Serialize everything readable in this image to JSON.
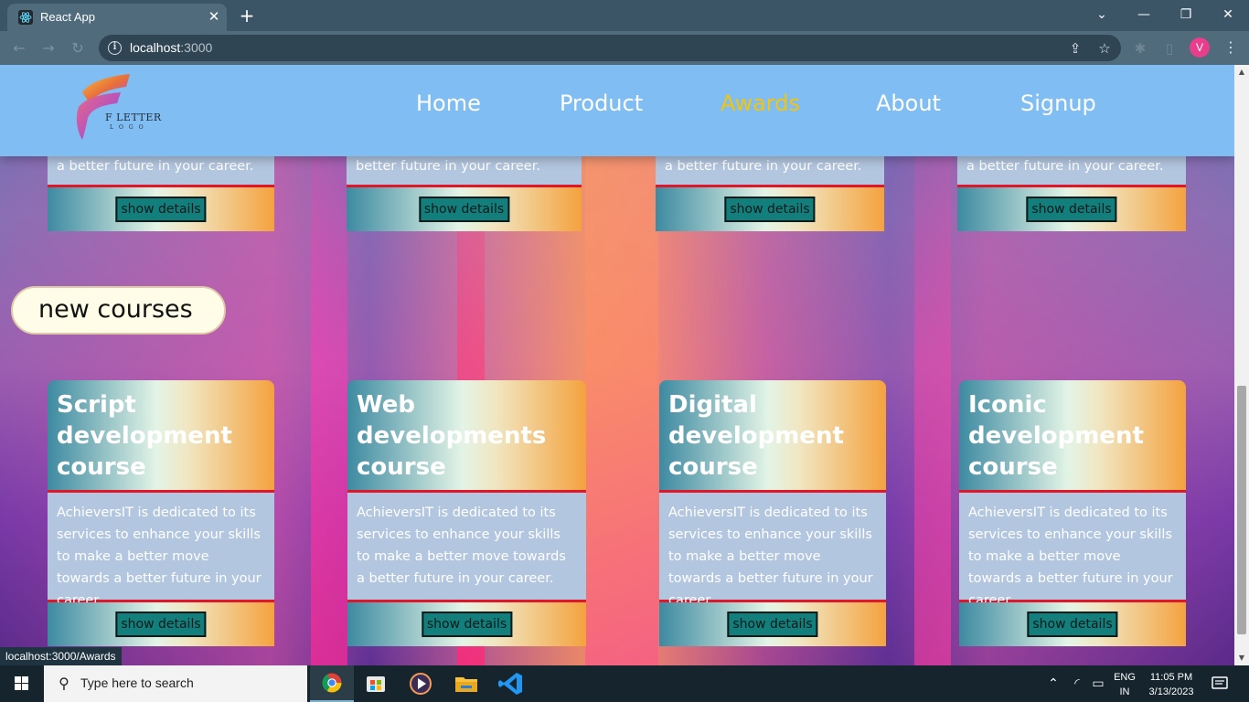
{
  "browser": {
    "tab_title": "React App",
    "tab_close": "✕",
    "new_tab": "+",
    "url_host": "localhost",
    "url_port": ":3000",
    "profile_initial": "V",
    "status_url": "localhost:3000/Awards",
    "window_controls": {
      "chevron": "⌄",
      "minimize": "—",
      "restore": "❐",
      "close": "✕"
    }
  },
  "site": {
    "logo_text": "F LETTER",
    "logo_sub": "LOGO",
    "nav": [
      {
        "label": "Home",
        "active": false
      },
      {
        "label": "Product",
        "active": false
      },
      {
        "label": "Awards",
        "active": true
      },
      {
        "label": "About",
        "active": false
      },
      {
        "label": "Signup",
        "active": false
      }
    ],
    "active_color": "#f1c40f",
    "header_color": "#80bdf2"
  },
  "top_cards": [
    {
      "text_tail": "a better future in your career.",
      "button": "show details"
    },
    {
      "text_tail": "better future in your career.",
      "button": "show details"
    },
    {
      "text_tail": "a better future in your career.",
      "button": "show details"
    },
    {
      "text_tail": "a better future in your career.",
      "button": "show details"
    }
  ],
  "section": {
    "title": "new courses"
  },
  "new_courses": [
    {
      "title": "Script development course",
      "text": "AchieversIT is dedicated to its services to enhance your skills to make a better move towards a better future in your career.",
      "button": "show details"
    },
    {
      "title": "Web developments course",
      "text": "AchieversIT is dedicated to its services to enhance your skills to make a better move towards a better future in your career.",
      "button": "show details"
    },
    {
      "title": "Digital development course",
      "text": "AchieversIT is dedicated to its services to enhance your skills to make a better move towards a better future in your career.",
      "button": "show details"
    },
    {
      "title": "Iconic development course",
      "text": "AchieversIT is dedicated to its services to enhance your skills to make a better move towards a better future in your career.",
      "button": "show details"
    }
  ],
  "taskbar": {
    "search_placeholder": "Type here to search",
    "lang_line1": "ENG",
    "lang_line2": "IN",
    "time": "11:05 PM",
    "date": "3/13/2023"
  }
}
